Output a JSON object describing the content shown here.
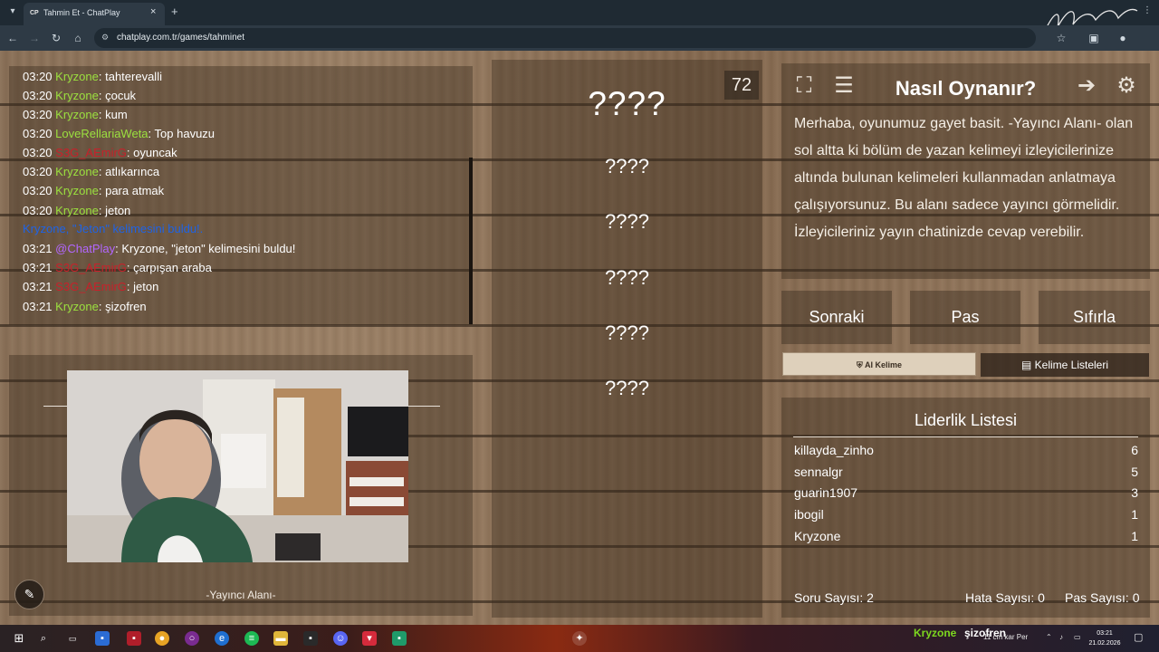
{
  "browser": {
    "tab_favicon": "CP",
    "tab_title": "Tahmin Et - ChatPlay",
    "tab_close": "×",
    "new_tab": "+",
    "url": "chatplay.com.tr/games/tahminet"
  },
  "chat": {
    "messages": [
      {
        "time": "03:20",
        "user": "Kryzone",
        "text": ": tahterevalli",
        "user_color": "#9be03f"
      },
      {
        "time": "03:20",
        "user": "Kryzone",
        "text": ": çocuk",
        "user_color": "#9be03f"
      },
      {
        "time": "03:20",
        "user": "Kryzone",
        "text": ": kum",
        "user_color": "#9be03f"
      },
      {
        "time": "03:20",
        "user": "LoveRellariaWeta",
        "text": ": Top havuzu",
        "user_color": "#9be03f"
      },
      {
        "time": "03:20",
        "user": "S3G_AEmirG",
        "text": ": oyuncak",
        "user_color": "#c8202a"
      },
      {
        "time": "03:20",
        "user": "Kryzone",
        "text": ": atlıkarınca",
        "user_color": "#9be03f"
      },
      {
        "time": "03:20",
        "user": "Kryzone",
        "text": ": para atmak",
        "user_color": "#9be03f"
      },
      {
        "time": "03:20",
        "user": "Kryzone",
        "text": ": jeton",
        "user_color": "#9be03f"
      },
      {
        "time": "",
        "user": "",
        "text": "Kryzone, \"Jeton\" kelimesini buldu!.",
        "text_color": "#1e63e6"
      },
      {
        "time": "03:21",
        "user": "@ChatPlay",
        "text": ": Kryzone, \"jeton\" kelimesini buldu!",
        "user_color": "#b266ff"
      },
      {
        "time": "03:21",
        "user": "S3G_AEmirG",
        "text": ": çarpışan araba",
        "user_color": "#c8202a"
      },
      {
        "time": "03:21",
        "user": "S3G_AEmirG",
        "text": ": jeton",
        "user_color": "#c8202a"
      },
      {
        "time": "03:21",
        "user": "Kryzone",
        "text": ": şizofren",
        "user_color": "#9be03f"
      }
    ]
  },
  "stream": {
    "label": "-Yayıncı Alanı-",
    "pencil_icon": "pencil-icon"
  },
  "game": {
    "timer": "72",
    "words": [
      "????",
      "????",
      "????",
      "????",
      "????",
      "????"
    ]
  },
  "howto": {
    "title": "Nasıl Oynanır?",
    "text": "Merhaba, oyunumuz gayet basit. -Yayıncı Alanı- olan sol altta ki bölüm de yazan kelimeyi izleyicilerinize altında bulunan kelimeleri kullanmadan anlatmaya çalışıyorsunuz. Bu alanı sadece yayıncı görmelidir. İzleyicileriniz yayın chatinizde cevap verebilir.",
    "icons": [
      "fullscreen-icon",
      "notes-icon",
      "exit-icon",
      "gear-icon"
    ]
  },
  "controls": {
    "next": "Sonraki",
    "pass": "Pas",
    "reset": "Sıfırla",
    "ai_word": "AI Kelime",
    "word_lists": "Kelime Listeleri"
  },
  "leaderboard": {
    "title": "Liderlik Listesi",
    "rows": [
      {
        "name": "killayda_zinho",
        "score": "6"
      },
      {
        "name": "sennalgr",
        "score": "5"
      },
      {
        "name": "guarin1907",
        "score": "3"
      },
      {
        "name": "ibogil",
        "score": "1"
      },
      {
        "name": "Kryzone",
        "score": "1"
      }
    ],
    "questions": "Soru Sayısı: 2",
    "errors": "Hata Sayısı: 0",
    "passes": "Pas Sayısı: 0"
  },
  "taskbar": {
    "overlay_user": "Kryzone",
    "overlay_text": "şizofren",
    "tray_text": "11 cm kar Per",
    "clock_time": "03:21",
    "clock_date": "21.02.2026"
  }
}
